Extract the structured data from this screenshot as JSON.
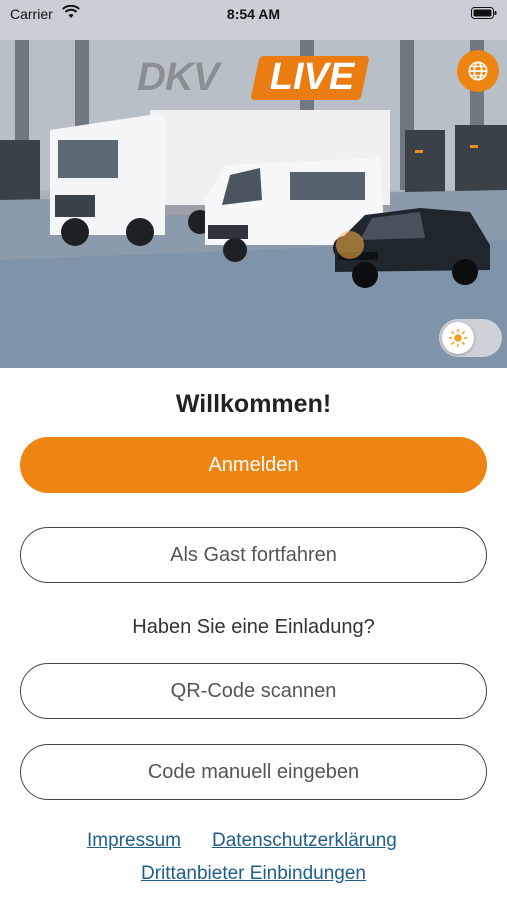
{
  "status_bar": {
    "carrier": "Carrier",
    "time": "8:54 AM"
  },
  "logo": {
    "dkv": "DKV",
    "live": "LIVE"
  },
  "hero": {
    "globe_icon": "globe-icon",
    "theme_toggle_icon": "sun-icon"
  },
  "welcome": {
    "title": "Willkommen!"
  },
  "actions": {
    "login_label": "Anmelden",
    "guest_label": "Als Gast fortfahren",
    "invite_question": "Haben Sie eine Einladung?",
    "qr_label": "QR-Code scannen",
    "manual_label": "Code manuell eingeben"
  },
  "footer": {
    "impressum": "Impressum",
    "privacy": "Datenschutzerklärung",
    "third_party": "Drittanbieter Einbindungen"
  },
  "colors": {
    "accent": "#ee8412",
    "link": "#1d5f8a"
  }
}
